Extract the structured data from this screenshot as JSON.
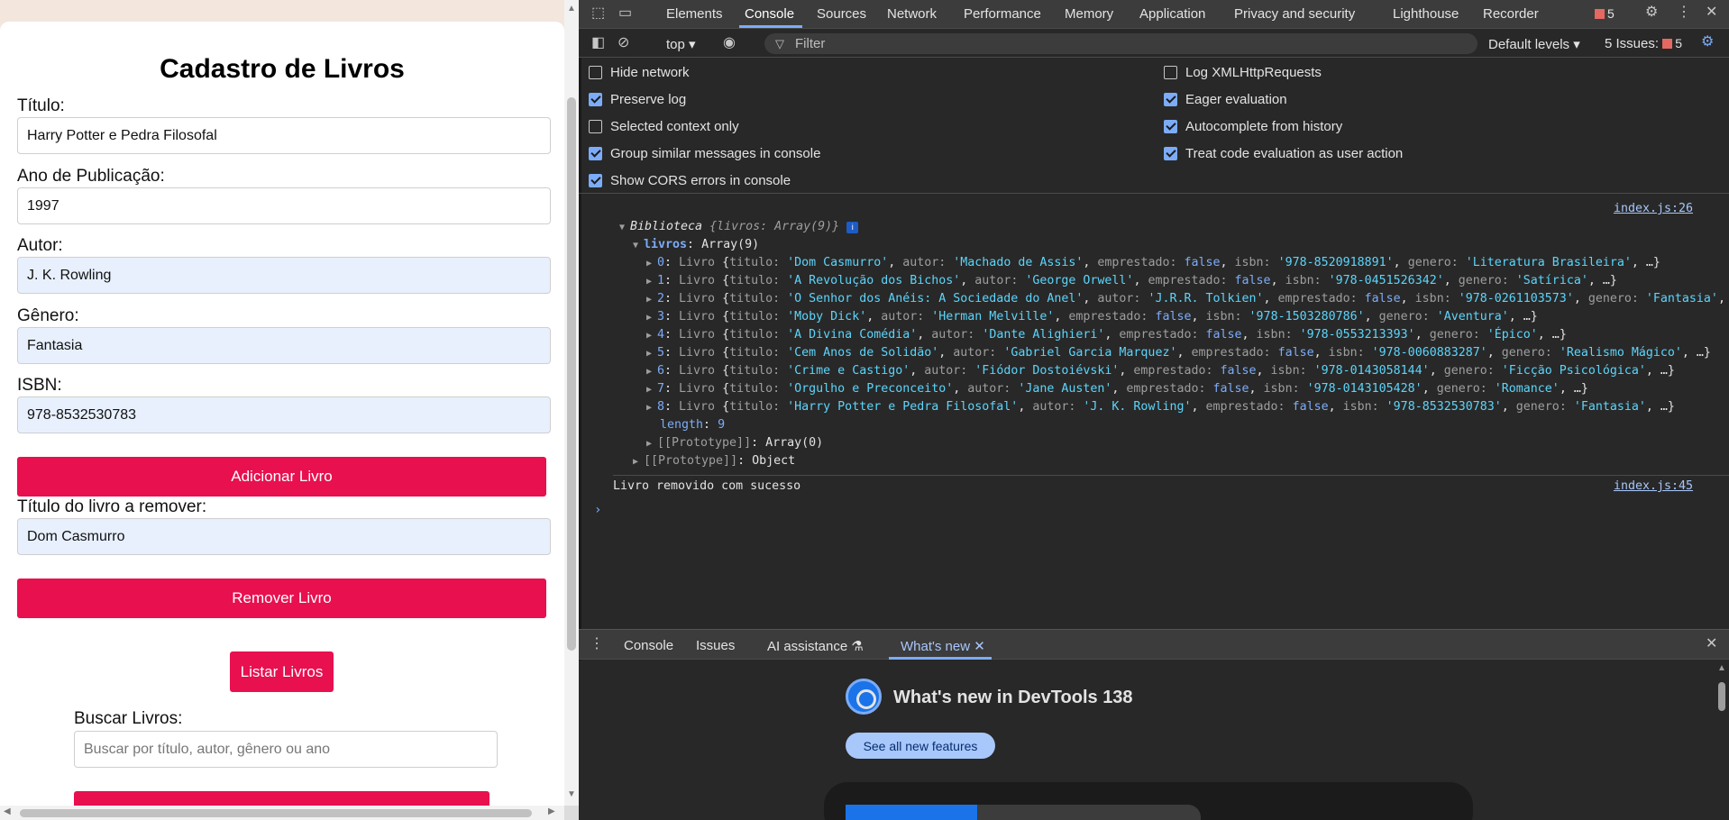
{
  "page": {
    "title": "Cadastro de Livros",
    "fields": [
      {
        "label": "Título:",
        "value": "Harry Potter e Pedra Filosofal"
      },
      {
        "label": "Ano de Publicação:",
        "value": "1997"
      },
      {
        "label": "Autor:",
        "value": "J. K. Rowling"
      },
      {
        "label": "Gênero:",
        "value": "Fantasia"
      },
      {
        "label": "ISBN:",
        "value": "978-8532530783"
      }
    ],
    "add_button": "Adicionar Livro",
    "remove_label": "Título do livro a remover:",
    "remove_value": "Dom Casmurro",
    "remove_button": "Remover Livro",
    "list_button": "Listar Livros",
    "search_label": "Buscar Livros:",
    "search_placeholder": "Buscar por título, autor, gênero ou ano",
    "accent_color": "#e8104f",
    "autofill_color": "#e8f0fe"
  },
  "devtools": {
    "tabs": [
      "Elements",
      "Console",
      "Sources",
      "Network",
      "Performance",
      "Memory",
      "Application",
      "Privacy and security",
      "Lighthouse",
      "Recorder"
    ],
    "active_tab": "Console",
    "issues_count": "5",
    "toolbar": {
      "context": "top",
      "filter_placeholder": "Filter",
      "levels": "Default levels",
      "issues_label": "5 Issues:",
      "issues_count": "5"
    },
    "settings_left": [
      {
        "label": "Hide network",
        "checked": false
      },
      {
        "label": "Preserve log",
        "checked": true
      },
      {
        "label": "Selected context only",
        "checked": false
      },
      {
        "label": "Group similar messages in console",
        "checked": true
      },
      {
        "label": "Show CORS errors in console",
        "checked": true
      }
    ],
    "settings_right": [
      {
        "label": "Log XMLHttpRequests",
        "checked": false
      },
      {
        "label": "Eager evaluation",
        "checked": true
      },
      {
        "label": "Autocomplete from history",
        "checked": true
      },
      {
        "label": "Treat code evaluation as user action",
        "checked": true
      }
    ],
    "console": {
      "source1": "index.js:26",
      "root_name": "Biblioteca",
      "root_preview": "{livros: Array(9)}",
      "livros_key": "livros",
      "livros_type": "Array(9)",
      "books": [
        {
          "idx": "0",
          "titulo": "'Dom Casmurro'",
          "autor": "'Machado de Assis'",
          "isbn": "'978-8520918891'",
          "genero": "'Literatura Brasileira'",
          "tail": ", …}"
        },
        {
          "idx": "1",
          "titulo": "'A Revolução dos Bichos'",
          "autor": "'George Orwell'",
          "isbn": "'978-0451526342'",
          "genero": "'Satírica'",
          "tail": ", …}"
        },
        {
          "idx": "2",
          "titulo": "'O Senhor dos Anéis: A Sociedade do Anel'",
          "autor": "'J.R.R. Tolkien'",
          "isbn": "'978-0261103573'",
          "genero": "'Fantasia'",
          "tail": ", …}"
        },
        {
          "idx": "3",
          "titulo": "'Moby Dick'",
          "autor": "'Herman Melville'",
          "isbn": "'978-1503280786'",
          "genero": "'Aventura'",
          "tail": ", …}"
        },
        {
          "idx": "4",
          "titulo": "'A Divina Comédia'",
          "autor": "'Dante Alighieri'",
          "isbn": "'978-0553213393'",
          "genero": "'Épico'",
          "tail": ", …}"
        },
        {
          "idx": "5",
          "titulo": "'Cem Anos de Solidão'",
          "autor": "'Gabriel Garcia Marquez'",
          "isbn": "'978-0060883287'",
          "genero": "'Realismo Mágico'",
          "tail": ", …}"
        },
        {
          "idx": "6",
          "titulo": "'Crime e Castigo'",
          "autor": "'Fiódor Dostoiévski'",
          "isbn": "'978-0143058144'",
          "genero": "'Ficção Psicológica'",
          "tail": ", …}"
        },
        {
          "idx": "7",
          "titulo": "'Orgulho e Preconceito'",
          "autor": "'Jane Austen'",
          "isbn": "'978-0143105428'",
          "genero": "'Romance'",
          "tail": ", …}"
        },
        {
          "idx": "8",
          "titulo": "'Harry Potter e Pedra Filosofal'",
          "autor": "'J. K. Rowling'",
          "isbn": "'978-8532530783'",
          "genero": "'Fantasia'",
          "tail": ", …}"
        }
      ],
      "length_key": "length",
      "length_val": "9",
      "proto_array": "Array(0)",
      "proto_object": "Object",
      "proto_key": "[[Prototype]]",
      "message": "Livro removido com sucesso",
      "source2": "index.js:45"
    },
    "drawer_tabs": [
      "Console",
      "Issues",
      "AI assistance",
      "What's new"
    ],
    "whats_new_title": "What's new in DevTools 138",
    "whats_new_button": "See all new features"
  }
}
